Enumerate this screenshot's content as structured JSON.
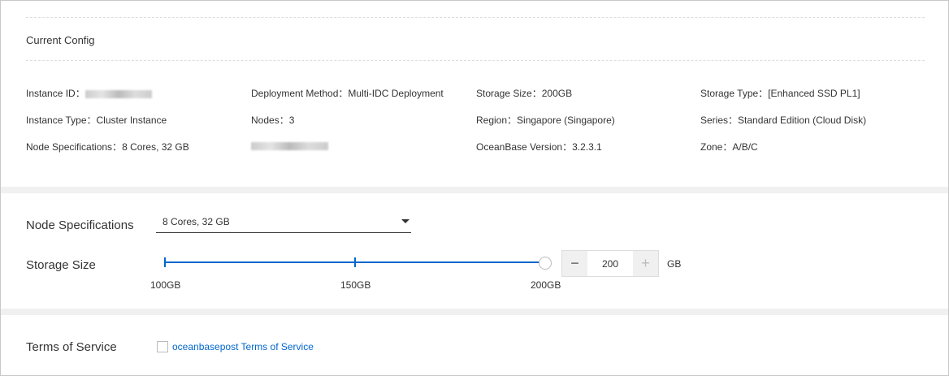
{
  "current_config": {
    "title": "Current Config",
    "rows": [
      [
        {
          "label": "Instance ID：",
          "value": ""
        },
        {
          "label": "Deployment Method：",
          "value": "Multi-IDC Deployment"
        },
        {
          "label": "Storage Size：",
          "value": "200GB"
        },
        {
          "label": "Storage Type：",
          "value": "[Enhanced SSD PL1]"
        }
      ],
      [
        {
          "label": "Instance Type：",
          "value": "Cluster Instance"
        },
        {
          "label": "Nodes：",
          "value": "3"
        },
        {
          "label": "Region：",
          "value": "Singapore (Singapore)"
        },
        {
          "label": "Series：",
          "value": "Standard Edition (Cloud Disk)"
        }
      ],
      [
        {
          "label": "Node Specifications：",
          "value": "8 Cores, 32 GB"
        },
        {
          "label": "",
          "value": ""
        },
        {
          "label": "OceanBase Version：",
          "value": "3.2.3.1"
        },
        {
          "label": "Zone：",
          "value": "A/B/C"
        }
      ]
    ]
  },
  "form": {
    "node_spec_label": "Node Specifications",
    "node_spec_value": "8 Cores, 32 GB",
    "storage_label": "Storage Size",
    "slider_marks": [
      "100GB",
      "150GB",
      "200GB"
    ],
    "slider_value_fraction": 1.0,
    "storage_value": "200",
    "minus": "−",
    "plus": "+",
    "unit": "GB"
  },
  "terms": {
    "label": "Terms of Service",
    "link": "oceanbasepost Terms of Service",
    "checked": false
  }
}
